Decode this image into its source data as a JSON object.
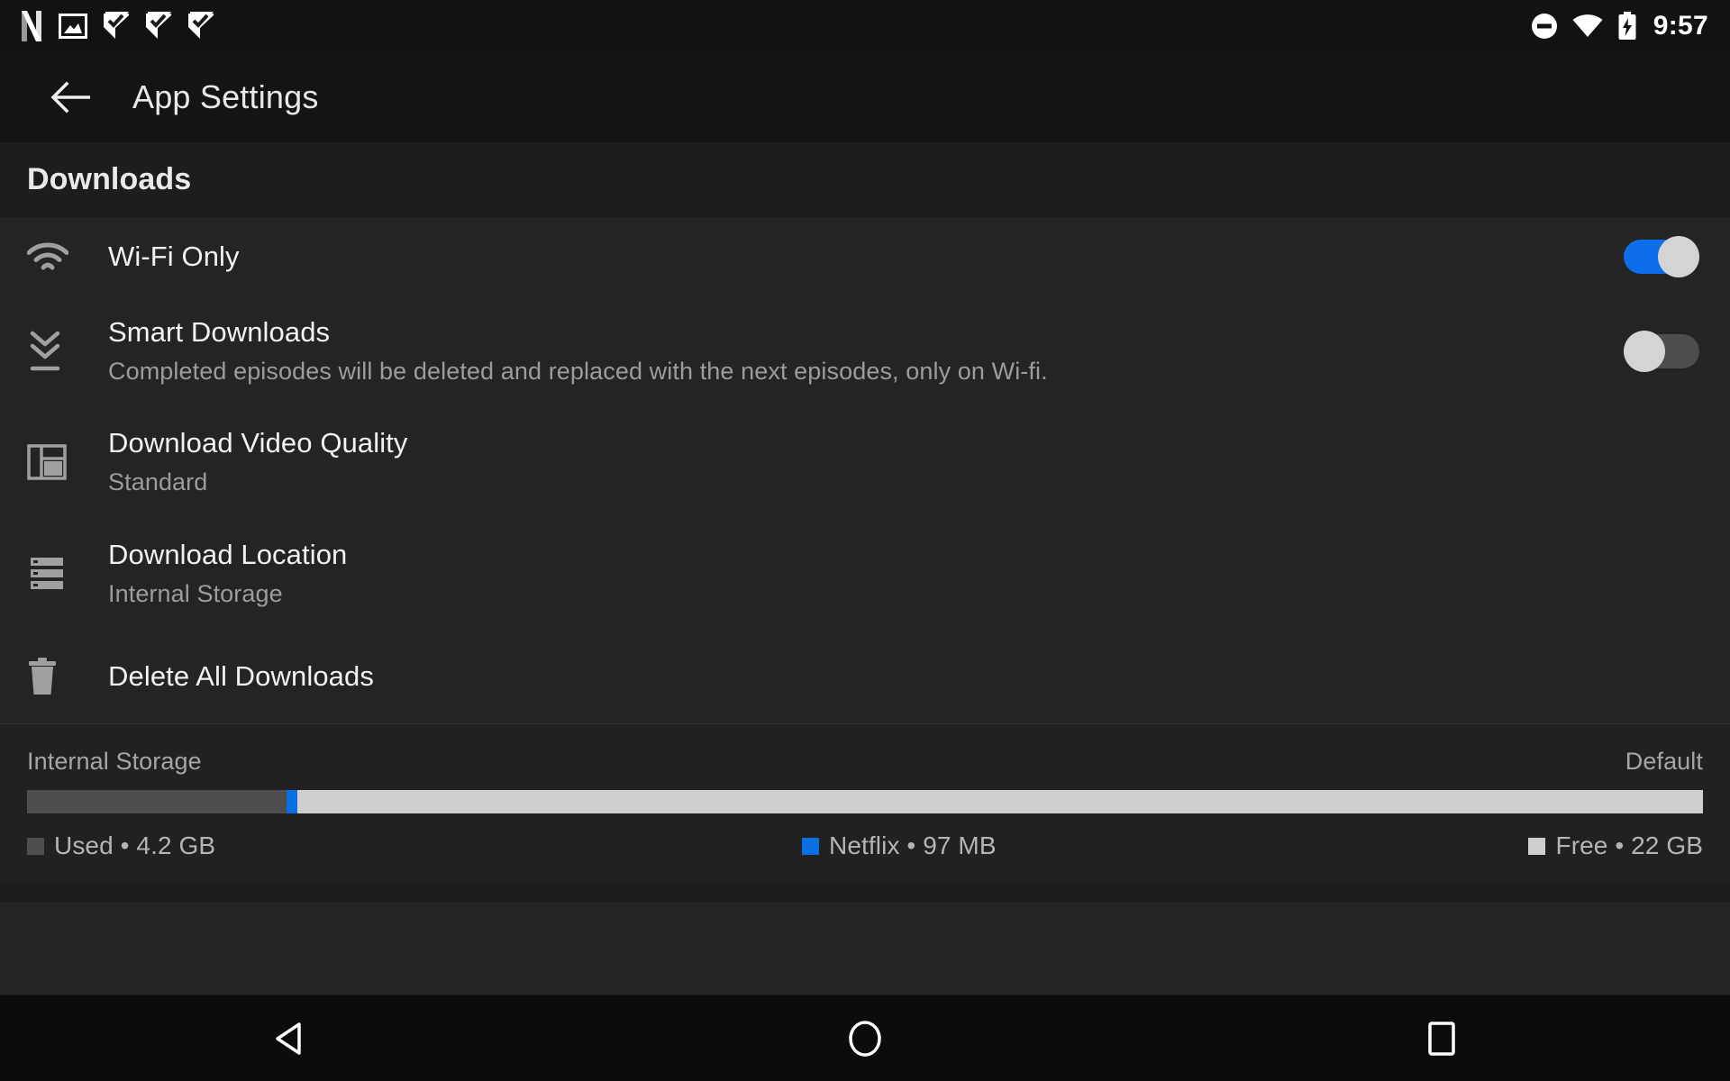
{
  "status_bar": {
    "left_icons": [
      {
        "name": "netflix-logo-icon",
        "label": "N"
      },
      {
        "name": "screenshot-image-icon",
        "label": "image"
      },
      {
        "name": "notification-flag-check-icon-1",
        "label": "flag"
      },
      {
        "name": "notification-flag-check-icon-2",
        "label": "flag"
      },
      {
        "name": "notification-flag-check-icon-3",
        "label": "flag"
      }
    ],
    "right_icons": [
      {
        "name": "do-not-disturb-icon",
        "label": "dnd"
      },
      {
        "name": "wifi-signal-icon",
        "label": "wifi"
      },
      {
        "name": "battery-charging-icon",
        "label": "battery"
      }
    ],
    "clock": "9:57"
  },
  "app_bar": {
    "back_label": "Back",
    "title": "App Settings"
  },
  "section": {
    "title": "Downloads"
  },
  "rows": {
    "wifi_only": {
      "icon": "wifi-icon",
      "title": "Wi-Fi Only",
      "toggle_state": "on"
    },
    "smart_downloads": {
      "icon": "download-chevrons-icon",
      "title": "Smart Downloads",
      "subtitle": "Completed episodes will be deleted and replaced with the next episodes, only on Wi-fi.",
      "toggle_state": "off"
    },
    "video_quality": {
      "icon": "video-quality-layout-icon",
      "title": "Download Video Quality",
      "value": "Standard"
    },
    "download_location": {
      "icon": "storage-stack-icon",
      "title": "Download Location",
      "value": "Internal Storage"
    },
    "delete_all": {
      "icon": "trash-icon",
      "title": "Delete All Downloads"
    }
  },
  "storage": {
    "name": "Internal Storage",
    "default_label": "Default",
    "bar": {
      "used_pct": 15.5,
      "netflix_pct": 0.62,
      "free_pct": 83.88
    },
    "legend": [
      {
        "name": "legend-used",
        "label": "Used • 4.2 GB",
        "color": "#4e4e4e"
      },
      {
        "name": "legend-netflix",
        "label": "Netflix • 97 MB",
        "color": "#0b6fe4"
      },
      {
        "name": "legend-free",
        "label": "Free • 22 GB",
        "color": "#cfcfcf"
      }
    ]
  },
  "nav_bar": {
    "back": "back-triangle-icon",
    "home": "home-circle-icon",
    "recents": "recents-square-icon"
  },
  "colors": {
    "accent_blue": "#0c6ee8",
    "page_bg": "#242424",
    "app_bar_bg": "#141414",
    "section_bg": "#1d1d1d",
    "text_primary": "#f2f2f2",
    "text_secondary": "#9c9c9c"
  }
}
